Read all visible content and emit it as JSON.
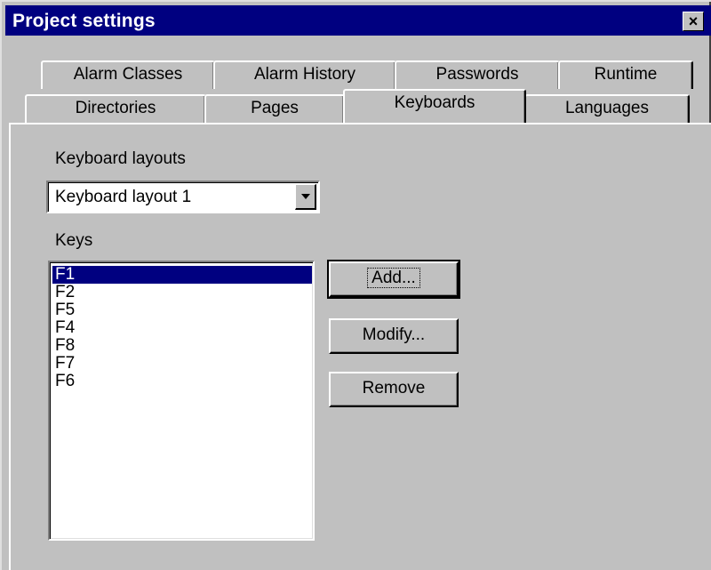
{
  "window": {
    "title": "Project settings",
    "close_glyph": "×"
  },
  "tabs": {
    "back_row": [
      "Alarm Classes",
      "Alarm History",
      "Passwords",
      "Runtime"
    ],
    "front_row": [
      "Directories",
      "Pages",
      "Keyboards",
      "Languages"
    ],
    "active": "Keyboards"
  },
  "keyboard": {
    "layouts_label": "Keyboard layouts",
    "selected_layout": "Keyboard layout 1",
    "keys_label": "Keys",
    "keys": [
      "F1",
      "F2",
      "F5",
      "F4",
      "F8",
      "F7",
      "F6"
    ],
    "selected_key": "F1"
  },
  "buttons": {
    "add": "Add...",
    "modify": "Modify...",
    "remove": "Remove"
  },
  "colors": {
    "titlebar": "#000080",
    "selection": "#000080",
    "face": "#c0c0c0"
  }
}
